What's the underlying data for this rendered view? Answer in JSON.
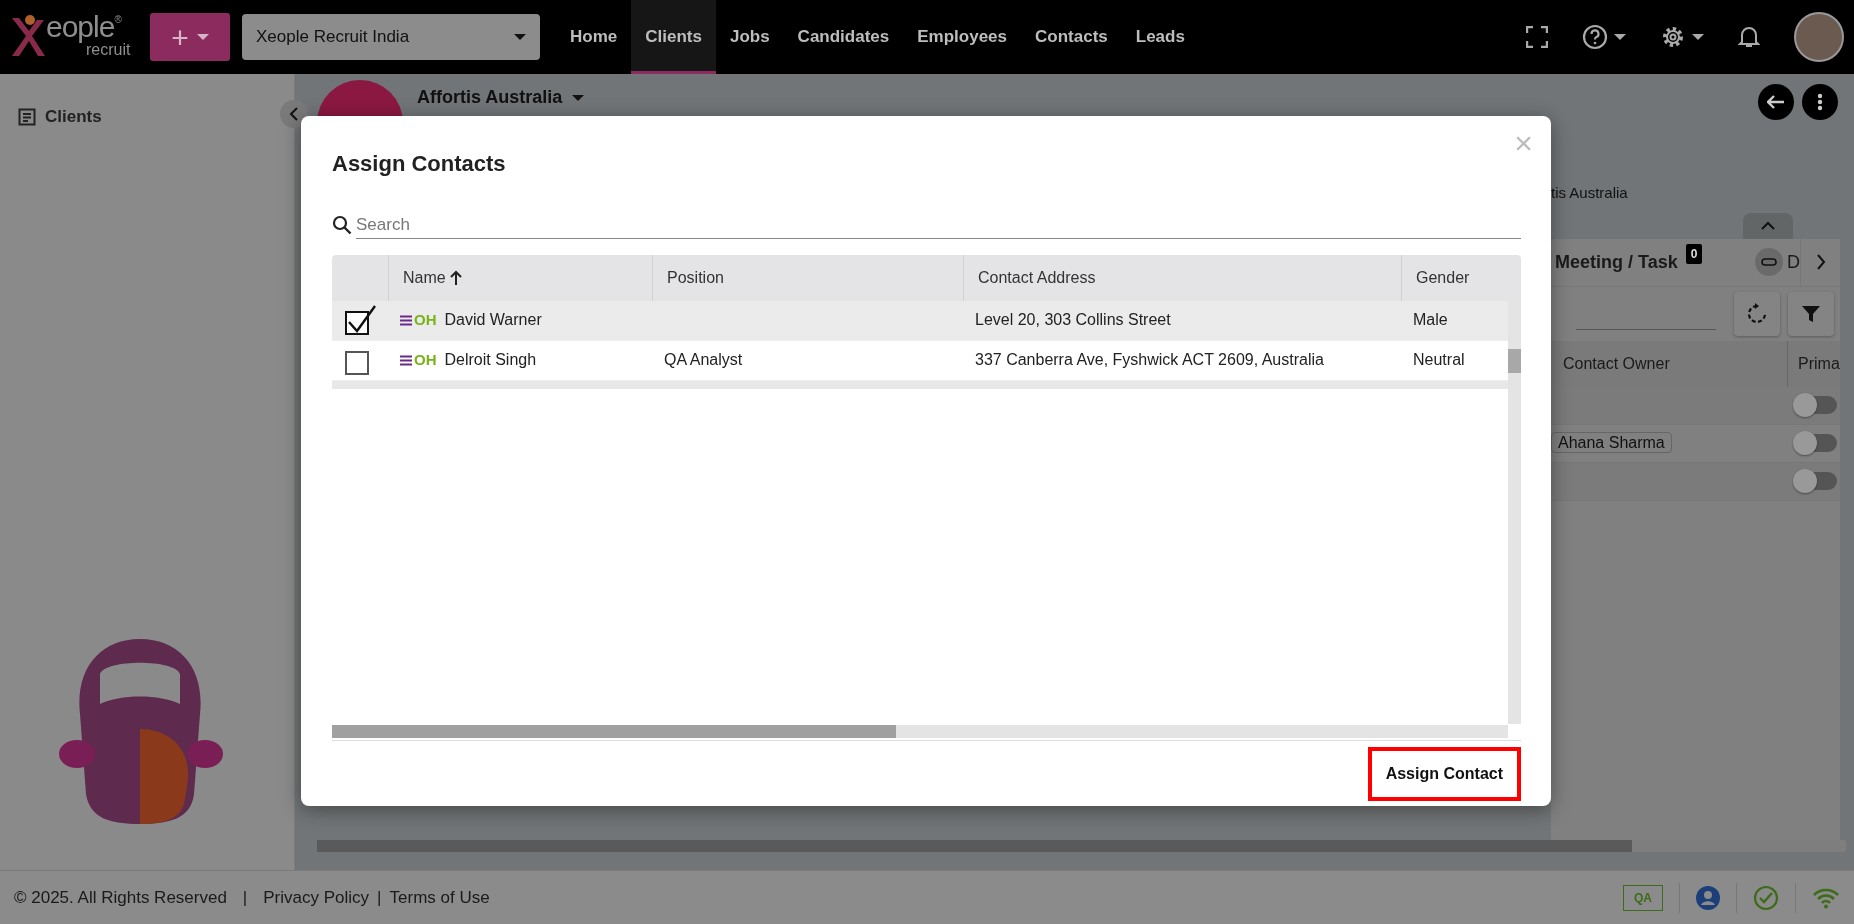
{
  "navbar": {
    "brand": "eople",
    "brand_mark": "®",
    "brand_sub": "recruit",
    "add": "+",
    "company": "Xeople Recruit India",
    "menu": [
      {
        "label": "Home",
        "selected": false
      },
      {
        "label": "Clients",
        "selected": true
      },
      {
        "label": "Jobs",
        "selected": false
      },
      {
        "label": "Candidates",
        "selected": false
      },
      {
        "label": "Employees",
        "selected": false
      },
      {
        "label": "Contacts",
        "selected": false
      },
      {
        "label": "Leads",
        "selected": false
      }
    ]
  },
  "sidebar": {
    "items": [
      {
        "label": "Clients"
      }
    ]
  },
  "client": {
    "name": "Affortis Australia",
    "subtitle": "tis Australia"
  },
  "side_panel": {
    "tab": "Meeting / Task",
    "badge": "0",
    "next_tab": "D",
    "columns": [
      "Contact Owner",
      "Prima"
    ],
    "rows": [
      {
        "primary": false
      },
      {
        "owner": "Ahana Sharma",
        "primary": false
      },
      {
        "primary": false
      }
    ]
  },
  "modal": {
    "title": "Assign Contacts",
    "close": "×",
    "search": {
      "placeholder": "Search"
    },
    "columns": [
      {
        "label": "Name",
        "sorted": true
      },
      {
        "label": "Position",
        "sorted": false
      },
      {
        "label": "Contact Address",
        "sorted": false
      },
      {
        "label": "Gender",
        "sorted": false
      }
    ],
    "rows": [
      {
        "checked": true,
        "selected": true,
        "tag": "OH",
        "name": "David Warner",
        "address": "Level 20, 303 Collins Street",
        "gender": "Male"
      },
      {
        "checked": false,
        "selected": false,
        "tag": "OH",
        "name": "Delroit Singh",
        "position": "QA Analyst",
        "address": "337 Canberra Ave, Fyshwick ACT 2609, Australia",
        "gender": "Neutral"
      }
    ],
    "button": "Assign Contact"
  },
  "footer": {
    "copyright": "© 2025. All Rights Reserved",
    "separators": [
      "|",
      "|"
    ],
    "links": [
      "Privacy Policy",
      "Terms of Use"
    ],
    "env": "QA"
  }
}
